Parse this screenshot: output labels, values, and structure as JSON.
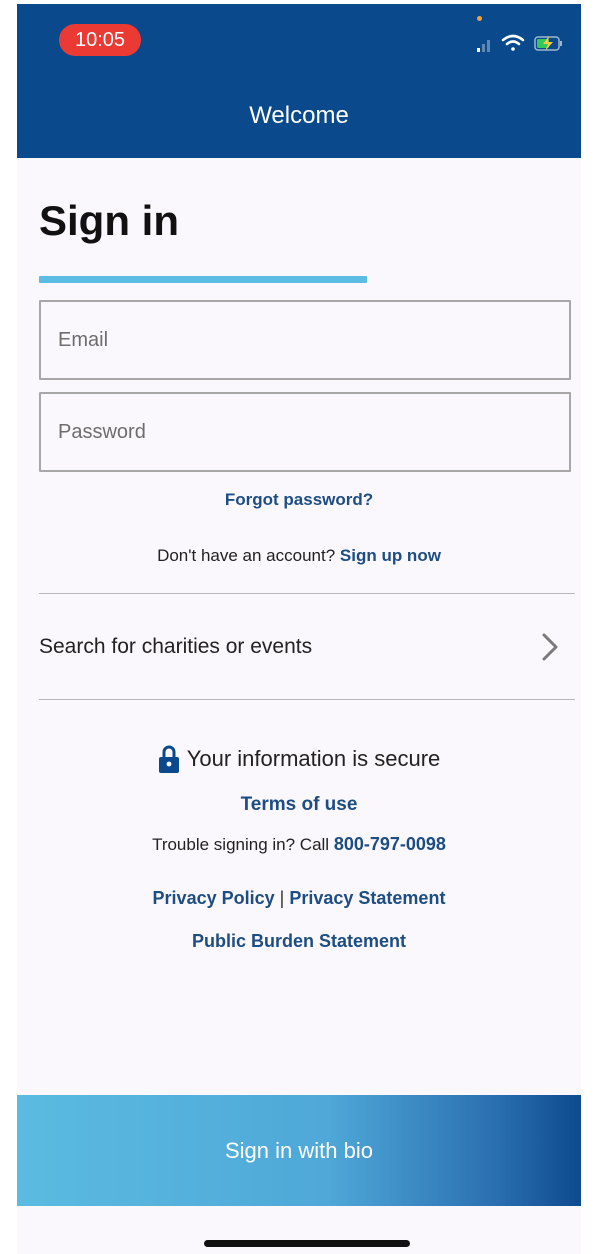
{
  "status_bar": {
    "time": "10:05"
  },
  "header": {
    "title": "Welcome"
  },
  "main": {
    "heading": "Sign in",
    "email_placeholder": "Email",
    "password_placeholder": "Password",
    "forgot_link": "Forgot password?",
    "signup_prompt": "Don't have an account?",
    "signup_link": "Sign up now",
    "search_label": "Search for charities or events",
    "secure_text": "Your information is secure",
    "terms_link": "Terms of use",
    "trouble_text": "Trouble signing in? Call",
    "phone_link": "800-797-0098",
    "privacy_policy_link": "Privacy Policy",
    "separator": "|",
    "privacy_statement_link": "Privacy Statement",
    "burden_link": "Public Burden Statement"
  },
  "footer": {
    "bio_button": "Sign in with bio"
  },
  "colors": {
    "header_bg": "#0a4a8c",
    "accent": "#5bbde4",
    "link": "#1d4d82",
    "time_pill": "#ea3a33"
  },
  "icons": [
    "signal-icon",
    "wifi-icon",
    "battery-charging-icon",
    "chevron-right-icon",
    "lock-icon"
  ]
}
